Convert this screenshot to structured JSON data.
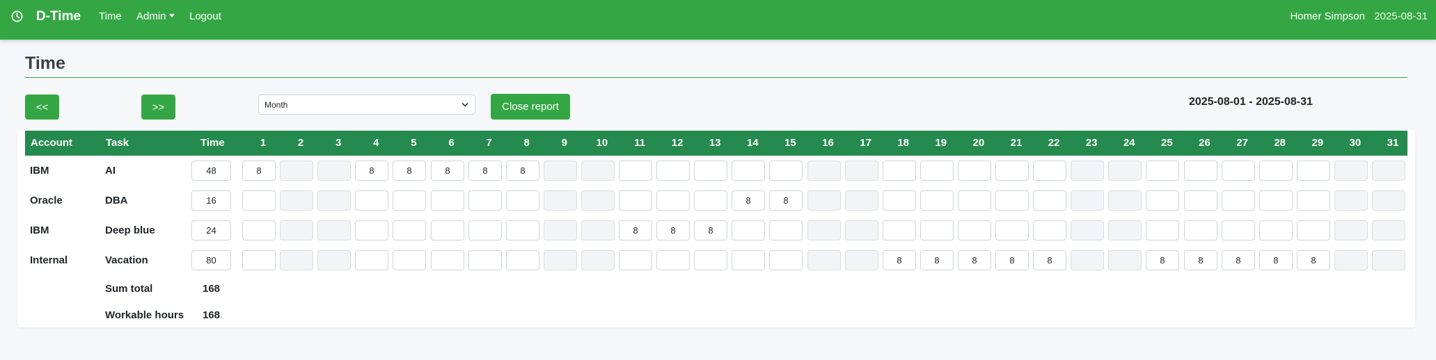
{
  "navbar": {
    "brand": "D-Time",
    "links": {
      "time": "Time",
      "admin": "Admin",
      "logout": "Logout"
    },
    "user": "Homer Simpson",
    "date": "2025-08-31"
  },
  "page": {
    "title": "Time"
  },
  "toolbar": {
    "prev_label": "<<",
    "next_label": ">>",
    "period_value": "Month",
    "close_label": "Close report",
    "date_range": "2025-08-01 - 2025-08-31"
  },
  "table": {
    "headers": {
      "account": "Account",
      "task": "Task",
      "time": "Time"
    },
    "days": [
      "1",
      "2",
      "3",
      "4",
      "5",
      "6",
      "7",
      "8",
      "9",
      "10",
      "11",
      "12",
      "13",
      "14",
      "15",
      "16",
      "17",
      "18",
      "19",
      "20",
      "21",
      "22",
      "23",
      "24",
      "25",
      "26",
      "27",
      "28",
      "29",
      "30",
      "31"
    ],
    "weekend_days": [
      2,
      3,
      9,
      10,
      16,
      17,
      23,
      24,
      30,
      31
    ],
    "rows": [
      {
        "account": "IBM",
        "task": "AI",
        "time": "48",
        "hours": [
          "8",
          "",
          "",
          "8",
          "8",
          "8",
          "8",
          "8",
          "",
          "",
          "",
          "",
          "",
          "",
          "",
          "",
          "",
          "",
          "",
          "",
          "",
          "",
          "",
          "",
          "",
          "",
          "",
          "",
          "",
          "",
          ""
        ]
      },
      {
        "account": "Oracle",
        "task": "DBA",
        "time": "16",
        "hours": [
          "",
          "",
          "",
          "",
          "",
          "",
          "",
          "",
          "",
          "",
          "",
          "",
          "",
          "8",
          "8",
          "",
          "",
          "",
          "",
          "",
          "",
          "",
          "",
          "",
          "",
          "",
          "",
          "",
          "",
          "",
          ""
        ]
      },
      {
        "account": "IBM",
        "task": "Deep blue",
        "time": "24",
        "hours": [
          "",
          "",
          "",
          "",
          "",
          "",
          "",
          "",
          "",
          "",
          "8",
          "8",
          "8",
          "",
          "",
          "",
          "",
          "",
          "",
          "",
          "",
          "",
          "",
          "",
          "",
          "",
          "",
          "",
          "",
          "",
          ""
        ]
      },
      {
        "account": "Internal",
        "task": "Vacation",
        "time": "80",
        "hours": [
          "",
          "",
          "",
          "",
          "",
          "",
          "",
          "",
          "",
          "",
          "",
          "",
          "",
          "",
          "",
          "",
          "",
          "8",
          "8",
          "8",
          "8",
          "8",
          "",
          "",
          "8",
          "8",
          "8",
          "8",
          "8",
          "",
          ""
        ]
      }
    ],
    "sum_label": "Sum total",
    "sum_value": "168",
    "workable_label": "Workable hours",
    "workable_value": "168"
  }
}
